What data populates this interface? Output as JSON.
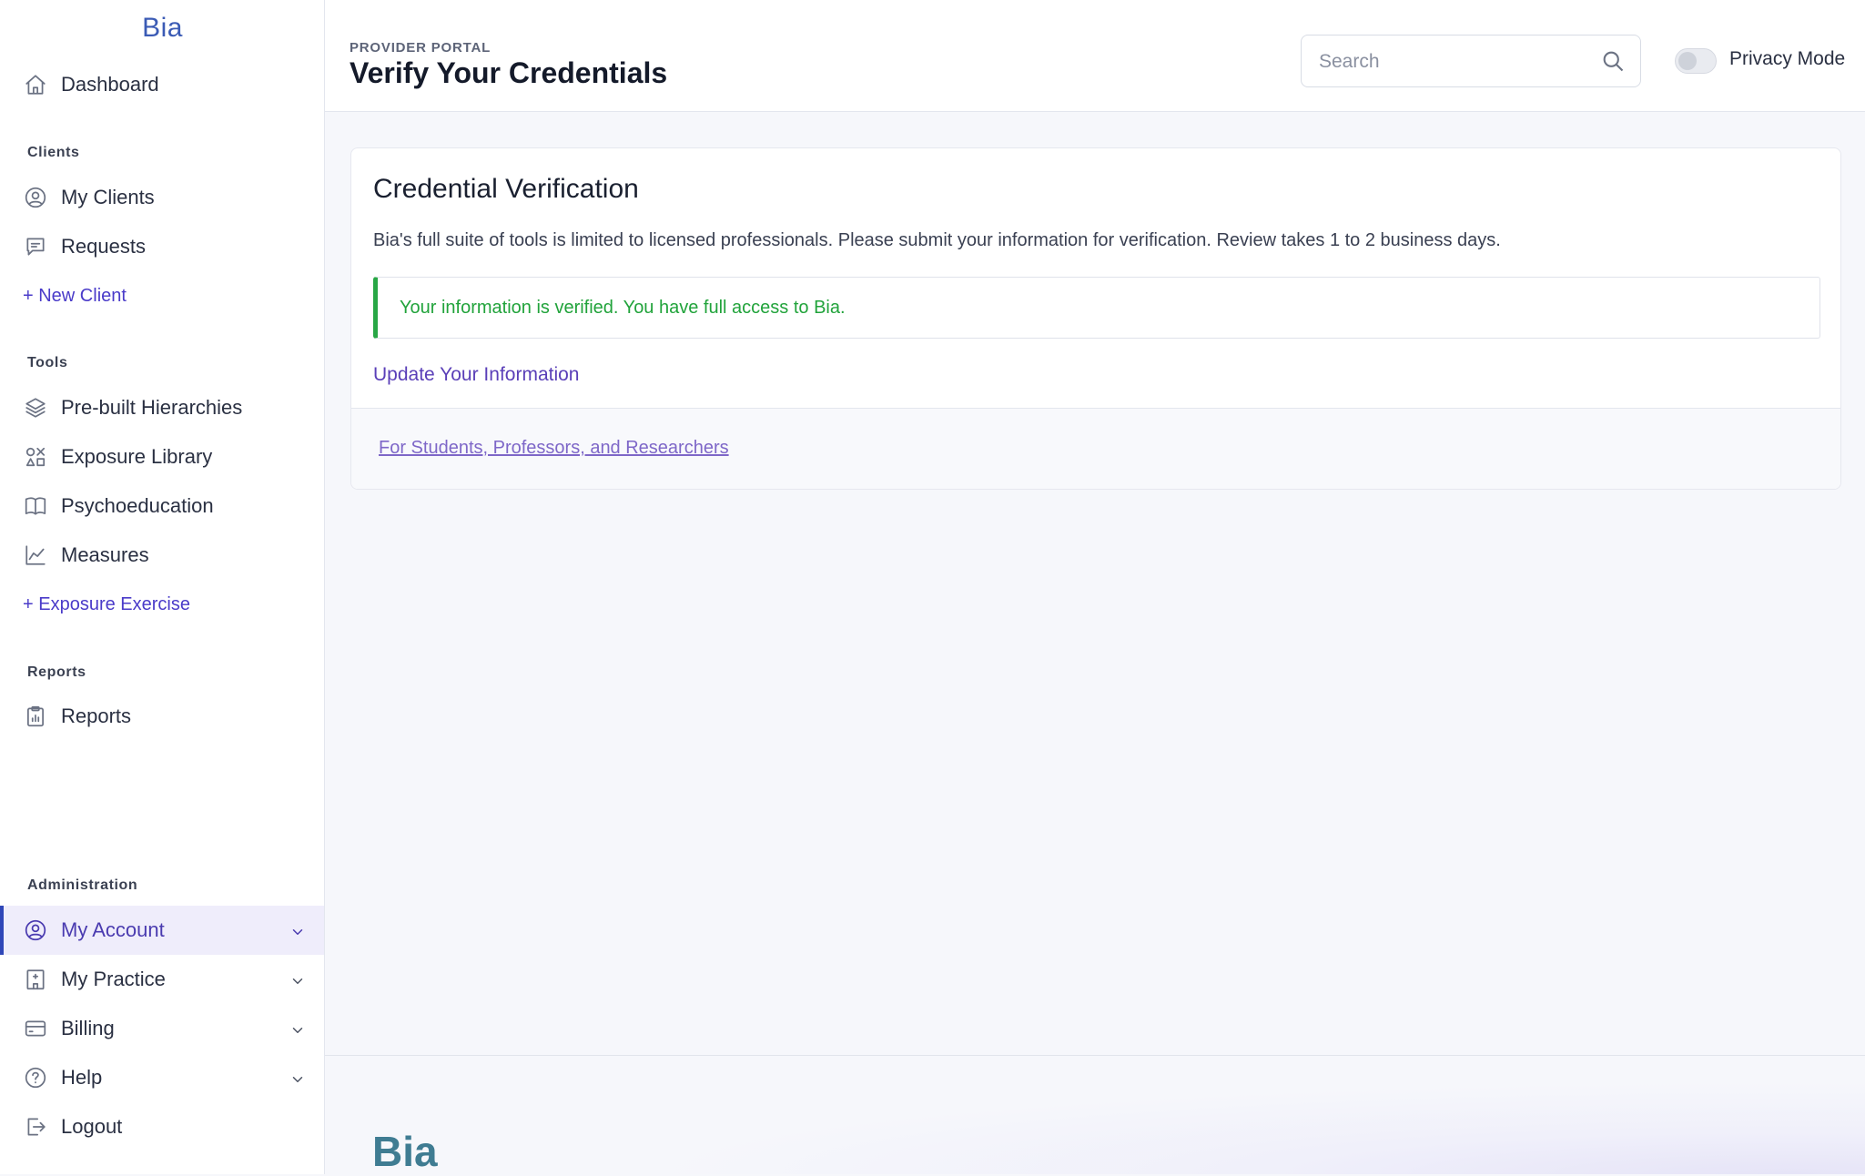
{
  "brand": {
    "name": "Bia"
  },
  "header": {
    "portal_label": "PROVIDER PORTAL",
    "title": "Verify Your Credentials",
    "search_placeholder": "Search",
    "privacy_mode_label": "Privacy Mode",
    "privacy_mode_on": false
  },
  "sidebar": {
    "dashboard": "Dashboard",
    "sections": {
      "clients": "Clients",
      "tools": "Tools",
      "reports": "Reports",
      "administration": "Administration"
    },
    "clients_items": {
      "my_clients": "My Clients",
      "requests": "Requests",
      "new_client": "+ New Client"
    },
    "tools_items": {
      "hierarchies": "Pre-built Hierarchies",
      "exposure_library": "Exposure Library",
      "psychoeducation": "Psychoeducation",
      "measures": "Measures",
      "exposure_exercise": "+ Exposure Exercise"
    },
    "reports_items": {
      "reports": "Reports"
    },
    "admin_items": {
      "my_account": "My Account",
      "my_practice": "My Practice",
      "billing": "Billing",
      "help": "Help",
      "logout": "Logout"
    },
    "active_item": "My Account"
  },
  "card": {
    "title": "Credential Verification",
    "description": "Bia's full suite of tools is limited to licensed professionals. Please submit your information for verification. Review takes 1 to 2 business days.",
    "status_message": "Your information is verified. You have full access to Bia.",
    "update_link": "Update Your Information",
    "students_link": "For Students, Professors, and Researchers"
  },
  "footer": {
    "logo": "Bia"
  },
  "colors": {
    "accent": "#4a3bc9",
    "success": "#28a745",
    "brand_blue": "#3b5bb5"
  }
}
